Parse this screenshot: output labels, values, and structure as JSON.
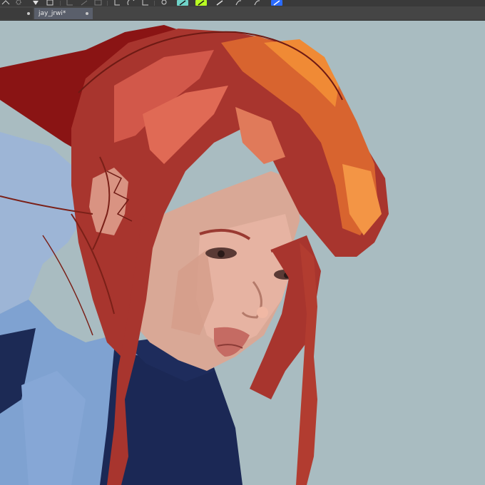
{
  "toolbar": {
    "items": [
      {
        "icon": "transform-icon"
      },
      {
        "icon": "selection-icon"
      },
      {
        "icon": "fill-icon"
      },
      {
        "icon": "bezier-icon"
      },
      {
        "icon": "ellipse-icon"
      },
      {
        "icon": "line-icon"
      },
      {
        "icon": "perspective-icon"
      },
      {
        "icon": "brush-preset-icon"
      },
      {
        "icon": "blend-mode-icon"
      },
      {
        "icon": "eraser-icon"
      },
      {
        "icon": "pen-icon"
      },
      {
        "icon": "smudge-icon"
      },
      {
        "icon": "color-icon"
      }
    ],
    "accent_lime": "#b9ff22",
    "accent_blue": "#2a6bff"
  },
  "tabs": {
    "active_label": "jay_jrwi*"
  },
  "canvas": {
    "background": "#a9bcc1",
    "artwork": "digital-painting"
  }
}
